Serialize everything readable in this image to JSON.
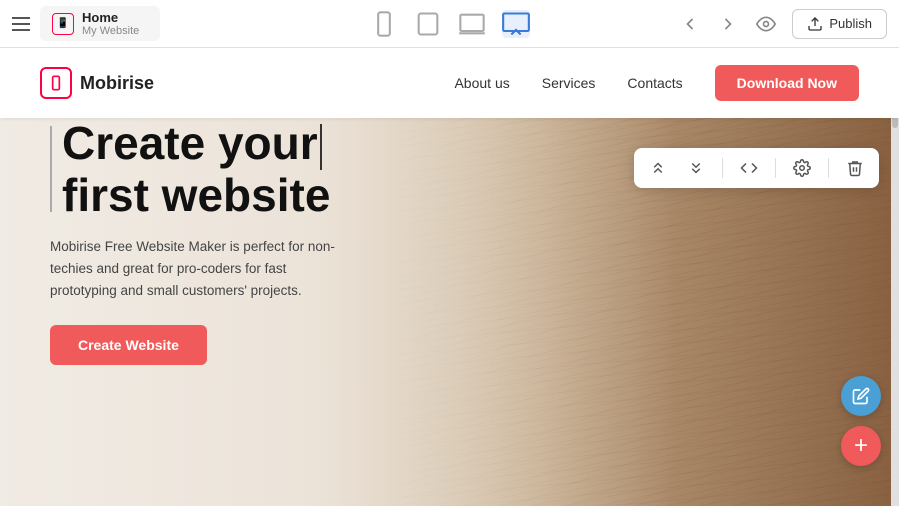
{
  "toolbar": {
    "tab_title": "Home",
    "tab_subtitle": "My Website",
    "publish_label": "Publish",
    "devices": [
      {
        "name": "mobile",
        "label": "Mobile"
      },
      {
        "name": "tablet",
        "label": "Tablet"
      },
      {
        "name": "laptop",
        "label": "Laptop"
      },
      {
        "name": "desktop",
        "label": "Desktop"
      }
    ]
  },
  "site": {
    "logo_text": "Mobirise",
    "nav": {
      "links": [
        "About us",
        "Services",
        "Contacts"
      ],
      "cta": "Download Now"
    },
    "hero": {
      "title_line1": "Create your",
      "title_line2": "first website",
      "description": "Mobirise Free Website Maker is perfect for non-techies and great for pro-coders for fast prototyping and small customers' projects.",
      "cta_label": "Create Website"
    }
  },
  "colors": {
    "primary": "#f05a5a",
    "accent_blue": "#4a9fd4",
    "toolbar_active": "#3a7bd5"
  },
  "icons": {
    "hamburger": "☰",
    "back": "←",
    "forward": "→",
    "eye": "👁",
    "upload": "↑",
    "arrow_up": "↑",
    "arrow_down": "↓",
    "code": "</>",
    "settings": "⚙",
    "trash": "🗑",
    "pencil": "✏",
    "plus": "+"
  }
}
